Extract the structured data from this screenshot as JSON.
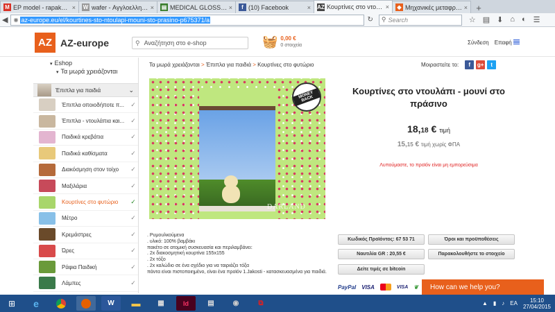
{
  "browser": {
    "tabs": [
      {
        "label": "EP model - rapakuli@g...",
        "favicon": "M",
        "color": "#d93025",
        "active": false
      },
      {
        "label": "wafer - Αγγλοελληνικό ...",
        "favicon": "W",
        "color": "#999999",
        "active": false
      },
      {
        "label": "MEDICAL GLOSSARY - ...",
        "favicon": "▤",
        "color": "#3a7d2c",
        "active": false
      },
      {
        "label": "(10) Facebook",
        "favicon": "f",
        "color": "#3b5998",
        "active": false
      },
      {
        "label": "Κουρτίνες στο ντουλάπ...",
        "favicon": "AZ",
        "color": "#444444",
        "active": true
      },
      {
        "label": "Μηχανικές μεταφράσει...",
        "favicon": "◆",
        "color": "#e8601c",
        "active": false
      }
    ],
    "url": "az-europe.eu/el/kourtines-sto-ntoulapi-mouni-sto-prasino-p675371/a",
    "search_placeholder": "Search"
  },
  "header": {
    "logo_mark": "AZ",
    "logo_text": "AZ-europe",
    "search_placeholder": "Αναζήτηση στο e-shop",
    "cart_amount": "0,00 €",
    "cart_items": "0 στοιχεία",
    "login": "Σύνδεση",
    "contact": "Επαφή"
  },
  "sidebar": {
    "root": "Eshop",
    "sub": "Τα μωρά χρειάζονται",
    "category": "Έπιπλα για παιδιά",
    "items": [
      {
        "label": "Έπιπλα οποιοδήποτε π...",
        "color": "#d8cfc2",
        "active": false
      },
      {
        "label": "Έπιπλα - ντουλάπια και...",
        "color": "#c9b79f",
        "active": false
      },
      {
        "label": "Παιδικά κρεβάτια",
        "color": "#e3b5d0",
        "active": false
      },
      {
        "label": "Παιδικά καθίσματα",
        "color": "#e8c97a",
        "active": false
      },
      {
        "label": "Διακόσμηση στον τοίχο",
        "color": "#b56a3a",
        "active": false
      },
      {
        "label": "Μαξιλάρια",
        "color": "#c74a5a",
        "active": false
      },
      {
        "label": "Κουρτίνες στο φυτώριο",
        "color": "#a8d66a",
        "active": true
      },
      {
        "label": "Μέτρο",
        "color": "#88c0e8",
        "active": false
      },
      {
        "label": "Κρεμάστρες",
        "color": "#6a4a2a",
        "active": false
      },
      {
        "label": "Ώρες",
        "color": "#d84a4a",
        "active": false
      },
      {
        "label": "Ράφια Παιδική",
        "color": "#6a9a3a",
        "active": false
      },
      {
        "label": "Λάμπες",
        "color": "#3a7a4a",
        "active": false
      }
    ]
  },
  "breadcrumb": [
    "Τα μωρά χρειάζονται",
    "Έπιπλα για παιδιά",
    "Κουρτίνες στο φυτώριο"
  ],
  "share": {
    "label": "Μοιραστείτε το:"
  },
  "product": {
    "badge": "MONEY BACK",
    "watermark": "DARLAND",
    "title": "Κουρτίνες στο ντουλάπι - μουνί στο πράσινο",
    "price_main": "18,",
    "price_cents": "18",
    "price_currency": "€",
    "price_label": "τιμή",
    "nvat_main": "15,",
    "nvat_cents": "15",
    "nvat_currency": "€",
    "nvat_label": "τιμή χωρίς ΦΠΑ",
    "out_of_stock": "Λυπούμαστε, το προϊόν είναι μη εμπορεύσιμα",
    "code_label": "Κωδικός Προϊόντος: 67 53 71",
    "shipping_label": "Ναυτιλία GR : 20,55 €",
    "bitcoin_label": "Δείτε τιμές σε bitcoin",
    "terms_label": "Όροι και προϋποθέσεις",
    "watch_label": "Παρακολουθήστε το στοιχείο",
    "description": [
      ". Ρυμουλκούμενα",
      ". υλικό: 100% βαμβάκι",
      "πακέτο σε ατομική συσκευασία και περιλαμβάνει:",
      ". 2x διακοσμητική κουρτίνα 155x155",
      ". 2x τόξο",
      ". 2x καλώδιο σε ένα σχέδιο για να ταιριάζει τόξα",
      "πάντα είναι πιστοποιημένο, είναι ένα προϊόν 1.Jakosti - κατασκευασμένα για παιδιά."
    ]
  },
  "payments": {
    "paypal": "PayPal",
    "visa": "VISA",
    "visa2": "VISA"
  },
  "chat": {
    "label": "How can we help you?"
  },
  "taskbar": {
    "lang": "EA",
    "time": "15:10",
    "date": "27/04/2015"
  }
}
